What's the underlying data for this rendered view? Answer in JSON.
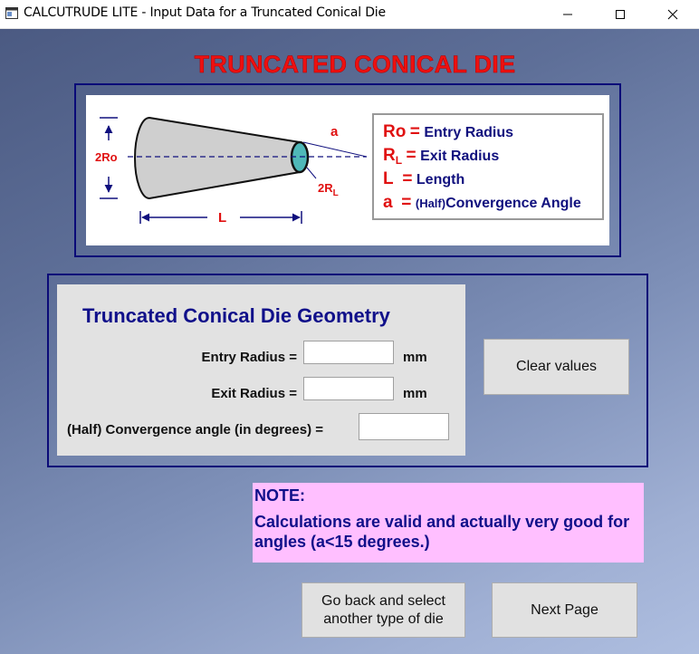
{
  "window": {
    "title": "CALCUTRUDE LITE - Input Data for a Truncated Conical Die"
  },
  "header": {
    "title": "TRUNCATED CONICAL DIE"
  },
  "diagram": {
    "labels": {
      "ro": "2Ro",
      "rl_main": "2R",
      "rl_sub": "L",
      "length": "L",
      "angle": "a"
    },
    "legend": [
      {
        "symbol": "Ro",
        "symbol_sub": "",
        "desc": "Entry Radius"
      },
      {
        "symbol": "R",
        "symbol_sub": "L",
        "desc": "Exit Radius"
      },
      {
        "symbol": "L",
        "symbol_sub": "",
        "desc": "Length"
      },
      {
        "symbol": "a",
        "symbol_sub": "",
        "prefix": "(Half)",
        "desc": "Convergence Angle"
      }
    ]
  },
  "geometry": {
    "title": "Truncated Conical Die Geometry",
    "entry_radius": {
      "label": "Entry Radius =",
      "value": "",
      "unit": "mm"
    },
    "exit_radius": {
      "label": "Exit Radius =",
      "value": "",
      "unit": "mm"
    },
    "angle": {
      "label": "(Half) Convergence angle (in degrees) =",
      "value": ""
    },
    "clear_button": "Clear values"
  },
  "note": {
    "title": "NOTE:",
    "body": "Calculations are valid and actually very good for angles (a<15 degrees.)"
  },
  "buttons": {
    "back": "Go back and select another type of die",
    "next": "Next Page"
  },
  "colors": {
    "title_red": "#ee1010",
    "navy": "#10108a",
    "note_bg": "#ffbfff",
    "cone_fill": "#cfcfcf",
    "exit_teal": "#4fb8b8"
  }
}
